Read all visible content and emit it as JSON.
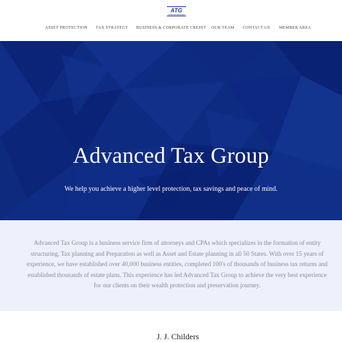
{
  "header": {
    "logo_text": "ATG",
    "nav": [
      {
        "label": "ASSET PROTECTION"
      },
      {
        "label": "TAX STRATEGY"
      },
      {
        "label": "BUSINESS & CORPORATE CREDIT"
      },
      {
        "label": "OUR TEAM"
      },
      {
        "label": "CONTACT US"
      },
      {
        "label": "MEMBER AREA"
      }
    ]
  },
  "hero": {
    "title": "Advanced Tax Group",
    "subtitle": "We help you achieve a higher level protection, tax savings and peace of mind."
  },
  "about": {
    "text": "Advanced Tax Group is a business service firm of attorneys and CPAs which specializes in the formation of entity structuring, Tax planning and Preparation as well as Asset and Estate planning in all 50 States. With over 15 years of experience, we have established over 40,000 business entities, completed 100's of thousands of business tax returns and established thousands of estate plans. This experience has led Advanced Tax Group to achieve the very best experience for our clients on their wealth protection and preservation journey."
  },
  "team": {
    "first_member_name": "J. J. Childers"
  },
  "colors": {
    "brand_navy": "#0c2a80",
    "about_bg": "#eef0fb",
    "logo_blue": "#1a3a8a"
  }
}
